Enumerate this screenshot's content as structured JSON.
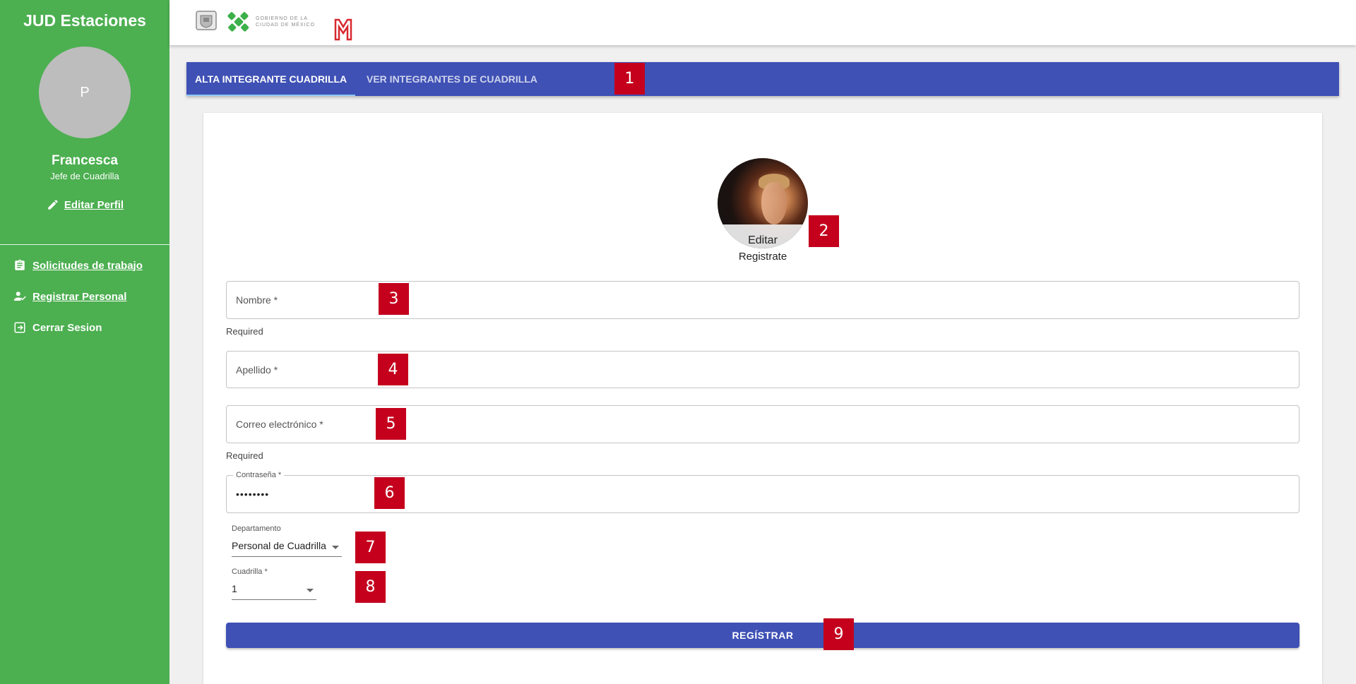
{
  "sidebar": {
    "app_title": "JUD Estaciones",
    "avatar_initial": "P",
    "user_name": "Francesca",
    "user_role": "Jefe de Cuadrilla",
    "edit_profile": "Editar Perfil",
    "items": [
      {
        "label": "Solicitudes de trabajo",
        "icon": "clipboard-icon"
      },
      {
        "label": "Registrar Personal",
        "icon": "person-check-icon"
      },
      {
        "label": "Cerrar Sesion",
        "icon": "logout-icon"
      }
    ]
  },
  "header": {
    "logos": [
      "cdmx-shield-logo",
      "gobierno-cdmx-logo",
      "metro-logo"
    ],
    "gobierno_text_line1": "GOBIERNO DE LA",
    "gobierno_text_line2": "CIUDAD DE MÉXICO"
  },
  "tabs": [
    {
      "label": "ALTA INTEGRANTE CUADRILLA",
      "active": true
    },
    {
      "label": "VER INTEGRANTES DE CUADRILLA",
      "active": false
    }
  ],
  "form": {
    "photo_edit_label": "Editar",
    "photo_caption": "Registrate",
    "nombre_placeholder": "Nombre *",
    "nombre_helper": "Required",
    "apellido_placeholder": "Apellido *",
    "correo_placeholder": "Correo electrónico  *",
    "correo_helper": "Required",
    "password_label": "Contraseña *",
    "password_value": "••••••••",
    "departamento_label": "Departamento",
    "departamento_value": "Personal de Cuadrilla",
    "cuadrilla_label": "Cuadrilla  *",
    "cuadrilla_value": "1",
    "submit_label": "REGÍSTRAR"
  },
  "markers": [
    "1",
    "2",
    "3",
    "4",
    "5",
    "6",
    "7",
    "8",
    "9"
  ],
  "colors": {
    "sidebar_green": "#4caf50",
    "primary_indigo": "#3f51b5",
    "marker_red": "#c4001d"
  }
}
